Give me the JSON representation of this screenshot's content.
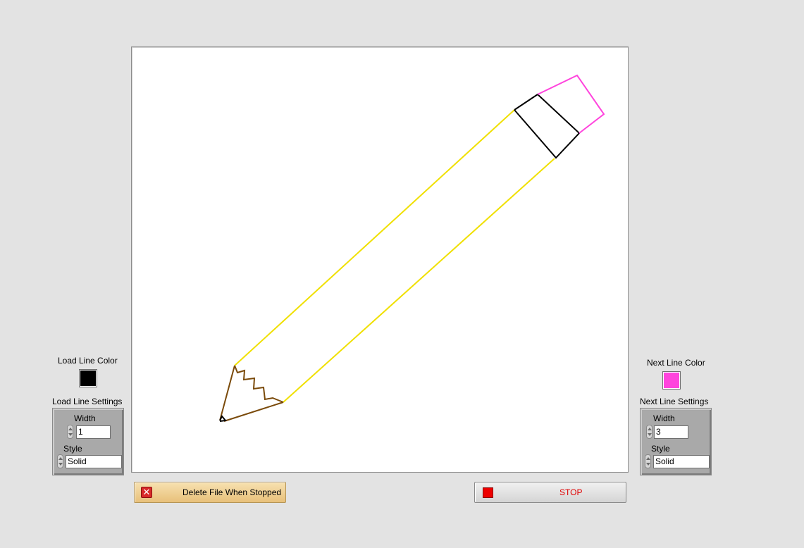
{
  "drawing_canvas": {
    "pencil_body_color": "#f0e000",
    "pencil_tip_color": "#7a4a0a",
    "ferrule_color": "#000000",
    "eraser_color": "#ff44dd"
  },
  "load_line": {
    "color_label": "Load Line Color",
    "color_value": "#000000",
    "settings_label": "Load Line Settings",
    "width_label": "Width",
    "width_value": "1",
    "style_label": "Style",
    "style_value": "Solid"
  },
  "next_line": {
    "color_label": "Next Line Color",
    "color_value": "#ff44dd",
    "settings_label": "Next Line Settings",
    "width_label": "Width",
    "width_value": "3",
    "style_label": "Style",
    "style_value": "Solid"
  },
  "buttons": {
    "delete_file_label": "Delete File When Stopped",
    "delete_icon": "close-x-icon",
    "stop_label": "STOP",
    "stop_icon": "stop-square-icon"
  }
}
